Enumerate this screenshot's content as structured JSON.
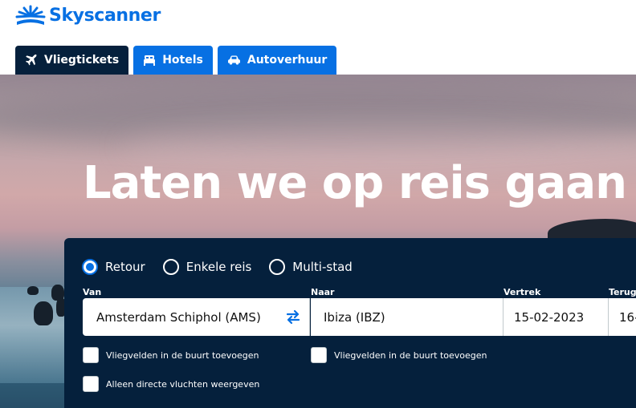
{
  "brand": {
    "name": "Skyscanner",
    "color": "#0770e3",
    "logo_icon": "sunrise-icon"
  },
  "tabs": [
    {
      "label": "Vliegtickets",
      "icon": "plane-icon",
      "active": true
    },
    {
      "label": "Hotels",
      "icon": "bed-icon",
      "active": false
    },
    {
      "label": "Autoverhuur",
      "icon": "car-icon",
      "active": false
    }
  ],
  "hero": {
    "headline": "Laten we op reis gaan"
  },
  "search": {
    "trip_types": [
      {
        "label": "Retour",
        "checked": true
      },
      {
        "label": "Enkele reis",
        "checked": false
      },
      {
        "label": "Multi-stad",
        "checked": false
      }
    ],
    "from": {
      "label": "Van",
      "value": "Amsterdam Schiphol (AMS)"
    },
    "to": {
      "label": "Naar",
      "value": "Ibiza (IBZ)"
    },
    "depart": {
      "label": "Vertrek",
      "value": "15-02-2023"
    },
    "return": {
      "label": "Terug",
      "value": "16-"
    },
    "swap_icon": "swap-arrows-icon",
    "options": {
      "nearby_from": "Vliegvelden in de buurt toevoegen",
      "nearby_to": "Vliegvelden in de buurt toevoegen",
      "direct_only": "Alleen directe vluchten weergeven"
    }
  },
  "colors": {
    "panel": "#05203c",
    "accent": "#0770e3"
  }
}
